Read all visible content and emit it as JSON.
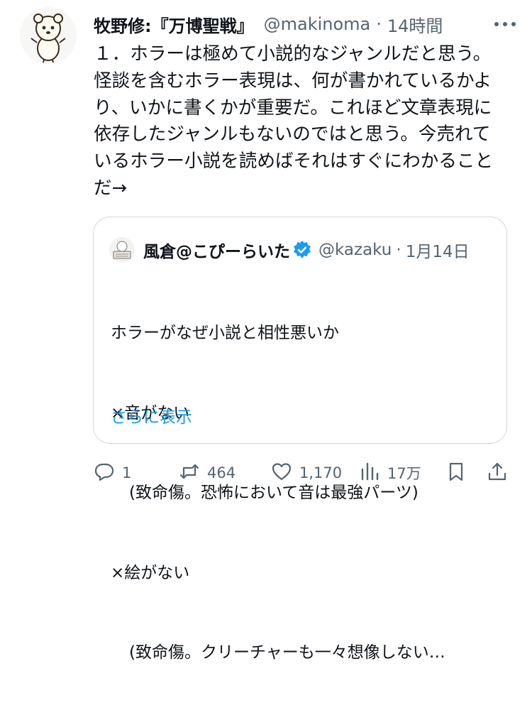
{
  "post": {
    "author_name": "牧野修:『万博聖戦』",
    "handle": "@makinoma",
    "separator": "·",
    "time": "14時間",
    "text": "１．ホラーは極めて小説的なジャンルだと思う。怪談を含むホラー表現は、何が書かれているかより、いかに書くかが重要だ。これほど文章表現に依存したジャンルもないのではと思う。今売れているホラー小説を読めばそれはすぐにわかることだ→"
  },
  "quote": {
    "author_name": "風倉@こぴーらいた",
    "handle": "@kazaku",
    "separator": "·",
    "date": "1月14日",
    "lines": [
      "ホラーがなぜ小説と相性悪いか",
      "×音がない",
      "(致命傷。恐怖において音は最強パーツ)",
      "×絵がない",
      "(致命傷。クリーチャーも一々想像しない…"
    ],
    "show_more": "さらに表示"
  },
  "actions": {
    "replies": "1",
    "reposts": "464",
    "likes": "1,170",
    "views": "17万"
  },
  "colors": {
    "text": "#0f1419",
    "secondary": "#536471",
    "link": "#1d9bf0",
    "border": "#cfd9de",
    "verified": "#1d9bf0"
  },
  "icons": [
    "more-icon",
    "verified-badge-icon",
    "reply-icon",
    "repost-icon",
    "like-icon",
    "views-icon",
    "bookmark-icon",
    "share-icon"
  ]
}
